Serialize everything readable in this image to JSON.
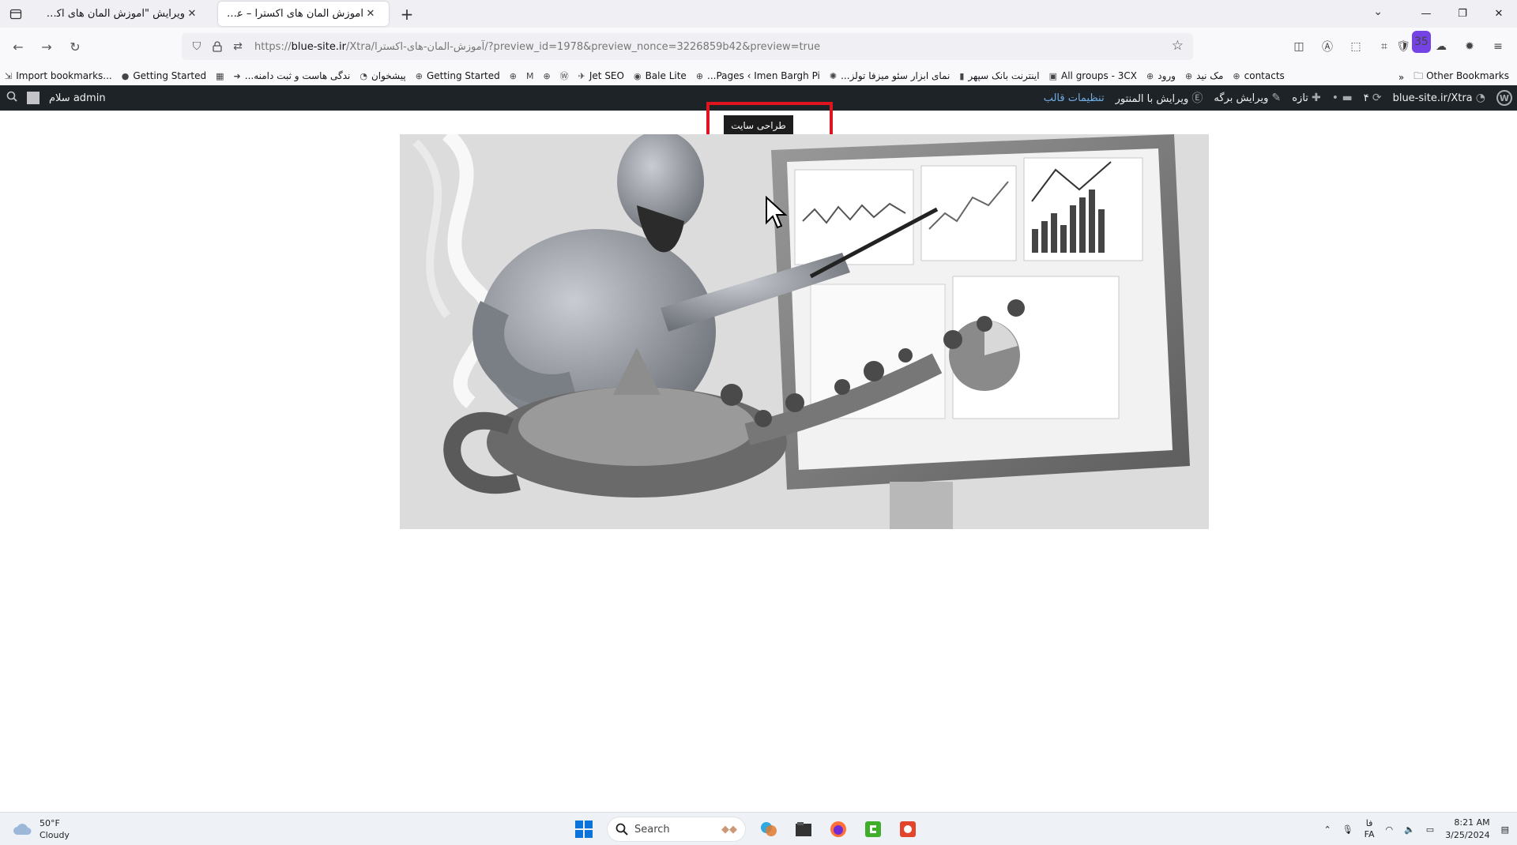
{
  "browser": {
    "tabs": [
      {
        "title": "ویرایش \"آموزش المان های اکسترا - ع",
        "active": false
      },
      {
        "title": "آموزش المان های اکسترا – علاءالدین",
        "active": true
      }
    ],
    "new_tab_symbol": "+",
    "url_prefix": "https://",
    "url_host": "blue-site.ir",
    "url_path": "/Xtra/آموزش-المان-های-اکسترا/?preview_id=1978&preview_nonce=3226859b42&preview=true",
    "extension_badge": "35"
  },
  "bookmarks": [
    {
      "label": "Import bookmarks...",
      "icon": "import-icon"
    },
    {
      "label": "Getting Started",
      "icon": "firefox-icon"
    },
    {
      "label": "",
      "icon": "calendar-icon"
    },
    {
      "label": "...ندگی هاست و ثبت دامنه",
      "icon": "arrow-icon"
    },
    {
      "label": "پیشخوان",
      "icon": "dashboard-icon"
    },
    {
      "label": "Getting Started",
      "icon": "globe-icon"
    },
    {
      "label": "",
      "icon": "globe-icon"
    },
    {
      "label": "",
      "icon": "gmail-icon"
    },
    {
      "label": "",
      "icon": "globe-icon"
    },
    {
      "label": "",
      "icon": "wordpress-icon"
    },
    {
      "label": "Jet SEO",
      "icon": "rocket-icon"
    },
    {
      "label": "Bale Lite",
      "icon": "bale-icon"
    },
    {
      "label": "...Pages ‹ Imen Bargh Pi",
      "icon": "globe-icon"
    },
    {
      "label": "...نمای ابزار سئو میزفا تولز",
      "icon": "mizfa-icon"
    },
    {
      "label": "اینترنت بانک سپهر",
      "icon": "bank-icon"
    },
    {
      "label": "All groups - 3CX",
      "icon": "3cx-icon"
    },
    {
      "label": "ورود",
      "icon": "globe-icon"
    },
    {
      "label": "مک نید",
      "icon": "globe-icon"
    },
    {
      "label": "contacts",
      "icon": "globe-icon"
    }
  ],
  "bookmarks_end": {
    "more": "»",
    "other": "Other Bookmarks"
  },
  "wp_admin_bar": {
    "greeting": "سلام admin",
    "site": "blue-site.ir/Xtra",
    "updates_count": "۴",
    "new_label": "تازه",
    "edit_page": "ویرایش برگه",
    "edit_elementor": "ویرایش با المنتور",
    "theme_settings": "تنظیمات قالب"
  },
  "page": {
    "button_label": "طراحی سایت",
    "hero_image_alt": "genie-lamp-dashboard-illustration"
  },
  "taskbar": {
    "weather_temp": "50°F",
    "weather_desc": "Cloudy",
    "search_label": "Search",
    "lang_top": "فا",
    "lang_bottom": "FA",
    "time": "8:21 AM",
    "date": "3/25/2024"
  }
}
